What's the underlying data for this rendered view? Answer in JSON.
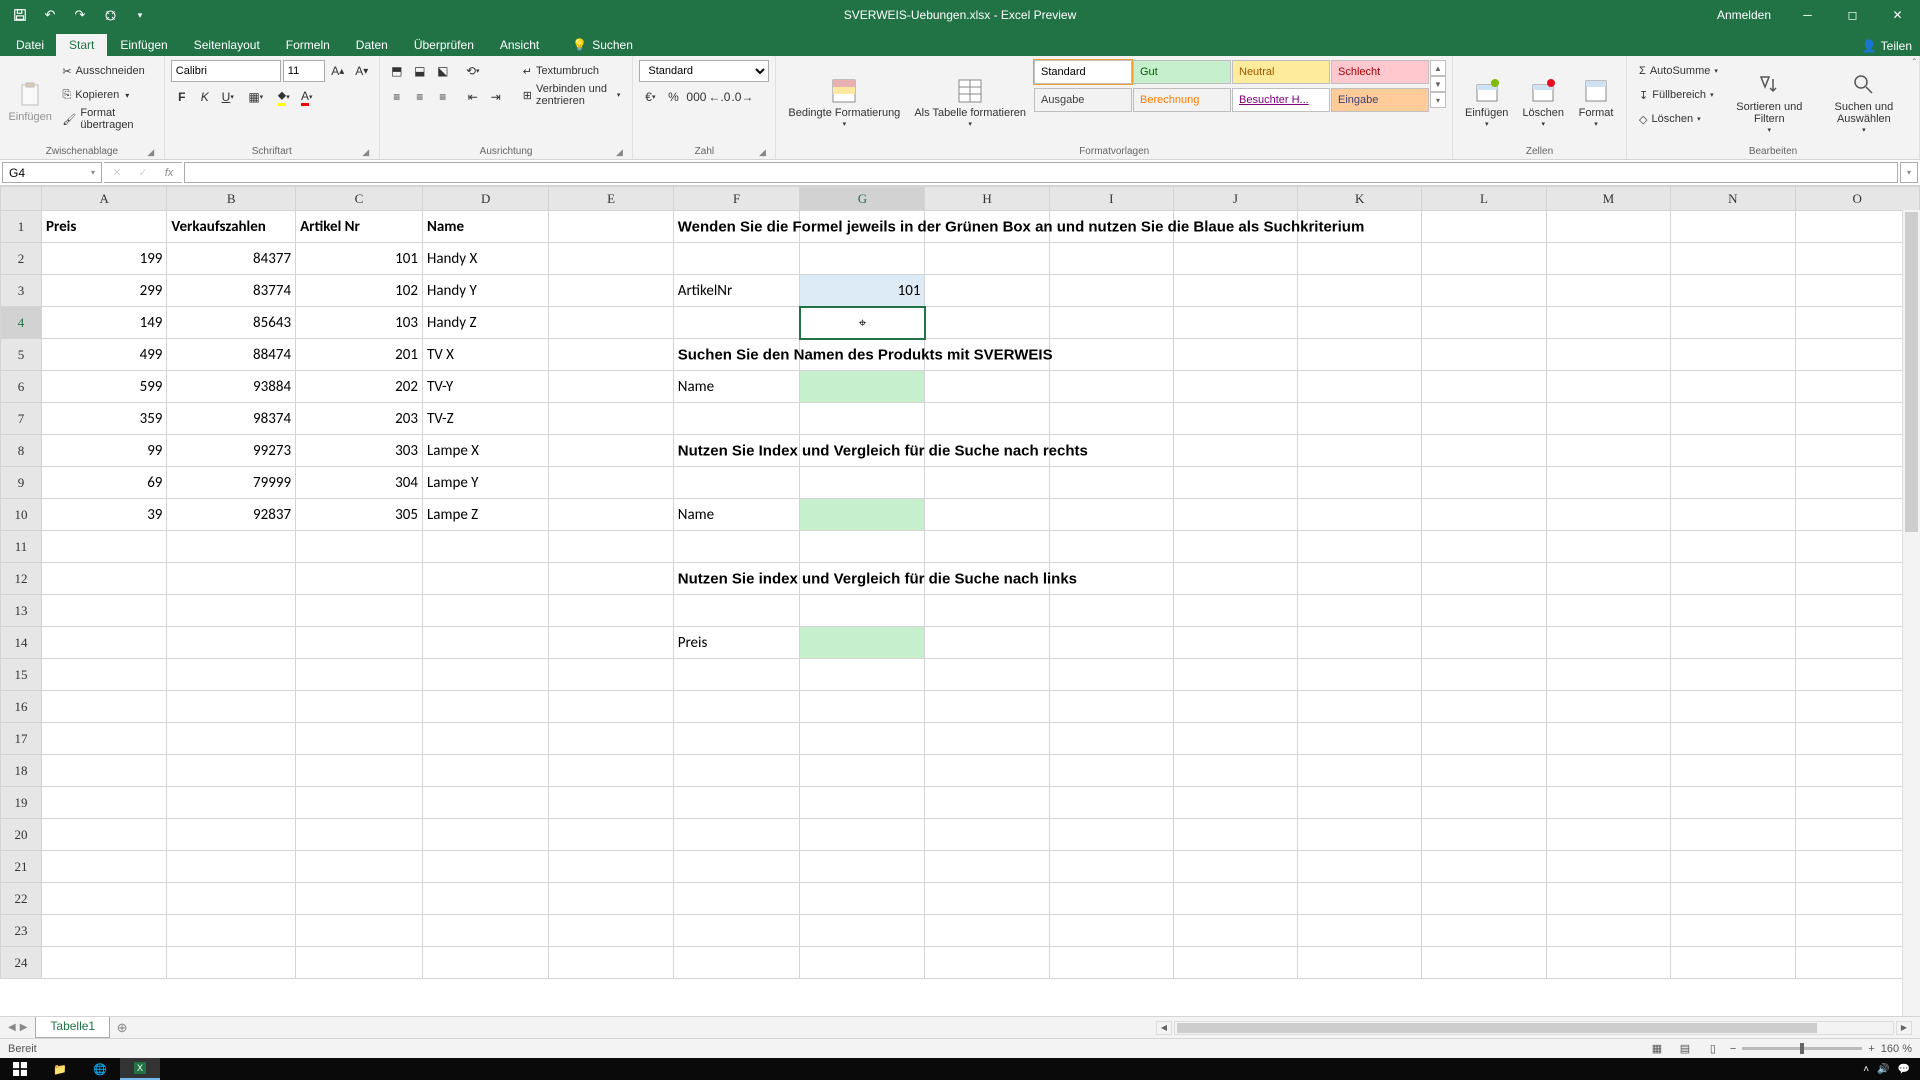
{
  "title": "SVERWEIS-Uebungen.xlsx - Excel Preview",
  "anmelden": "Anmelden",
  "teilen": "Teilen",
  "menu": {
    "datei": "Datei",
    "start": "Start",
    "einfuegen": "Einfügen",
    "seitenlayout": "Seitenlayout",
    "formeln": "Formeln",
    "daten": "Daten",
    "ueberpruefen": "Überprüfen",
    "ansicht": "Ansicht",
    "suchen": "Suchen"
  },
  "ribbon": {
    "einfuegen": "Einfügen",
    "ausschneiden": "Ausschneiden",
    "kopieren": "Kopieren",
    "format_uebertragen": "Format übertragen",
    "zwischenablage": "Zwischenablage",
    "font_name": "Calibri",
    "font_size": "11",
    "schriftart": "Schriftart",
    "ausrichtung": "Ausrichtung",
    "textumbruch": "Textumbruch",
    "verbinden": "Verbinden und zentrieren",
    "zahl_format": "Standard",
    "zahl": "Zahl",
    "bedingte": "Bedingte Formatierung",
    "als_tabelle": "Als Tabelle formatieren",
    "formatvorlagen": "Formatvorlagen",
    "standard": "Standard",
    "gut": "Gut",
    "neutral": "Neutral",
    "schlecht": "Schlecht",
    "ausgabe": "Ausgabe",
    "berechnung": "Berechnung",
    "besuchter": "Besuchter H...",
    "eingabe": "Eingabe",
    "einfuegen2": "Einfügen",
    "loeschen": "Löschen",
    "format": "Format",
    "zellen": "Zellen",
    "autosumme": "AutoSumme",
    "fuellbereich": "Füllbereich",
    "loeschen2": "Löschen",
    "sortieren": "Sortieren und Filtern",
    "suchen_ausw": "Suchen und Auswählen",
    "bearbeiten": "Bearbeiten"
  },
  "namebox": "G4",
  "columns": [
    "A",
    "B",
    "C",
    "D",
    "E",
    "F",
    "G",
    "H",
    "I",
    "J",
    "K",
    "L",
    "M",
    "N",
    "O"
  ],
  "col_widths": [
    "w-A",
    "w-B",
    "w-C",
    "w-D",
    "w-E",
    "w-F",
    "w-G",
    "w-H",
    "w-I",
    "w-J",
    "w-K",
    "w-L",
    "w-M",
    "w-N",
    "w-O"
  ],
  "headers": {
    "A": "Preis",
    "B": "Verkaufszahlen",
    "C": "Artikel Nr",
    "D": "Name"
  },
  "instruction_F1": "Wenden Sie die Formel jeweils in der Grünen Box an und nutzen Sie die Blaue als Suchkriterium",
  "label_F3": "ArtikelNr",
  "value_G3": "101",
  "instruction_F5": "Suchen Sie den Namen des Produkts mit SVERWEIS",
  "label_F6": "Name",
  "instruction_F8": "Nutzen Sie Index und Vergleich für die Suche nach rechts",
  "label_F10": "Name",
  "instruction_F12": "Nutzen Sie index und Vergleich für die Suche nach links",
  "label_F14": "Preis",
  "data": [
    {
      "preis": "199",
      "verk": "84377",
      "art": "101",
      "name": "Handy X"
    },
    {
      "preis": "299",
      "verk": "83774",
      "art": "102",
      "name": "Handy Y"
    },
    {
      "preis": "149",
      "verk": "85643",
      "art": "103",
      "name": "Handy Z"
    },
    {
      "preis": "499",
      "verk": "88474",
      "art": "201",
      "name": "TV X"
    },
    {
      "preis": "599",
      "verk": "93884",
      "art": "202",
      "name": "TV-Y"
    },
    {
      "preis": "359",
      "verk": "98374",
      "art": "203",
      "name": "TV-Z"
    },
    {
      "preis": "99",
      "verk": "99273",
      "art": "303",
      "name": "Lampe X"
    },
    {
      "preis": "69",
      "verk": "79999",
      "art": "304",
      "name": "Lampe Y"
    },
    {
      "preis": "39",
      "verk": "92837",
      "art": "305",
      "name": "Lampe Z"
    }
  ],
  "sheet_tab": "Tabelle1",
  "status": "Bereit",
  "zoom": "160 %",
  "active_col": "G",
  "active_row": 4
}
